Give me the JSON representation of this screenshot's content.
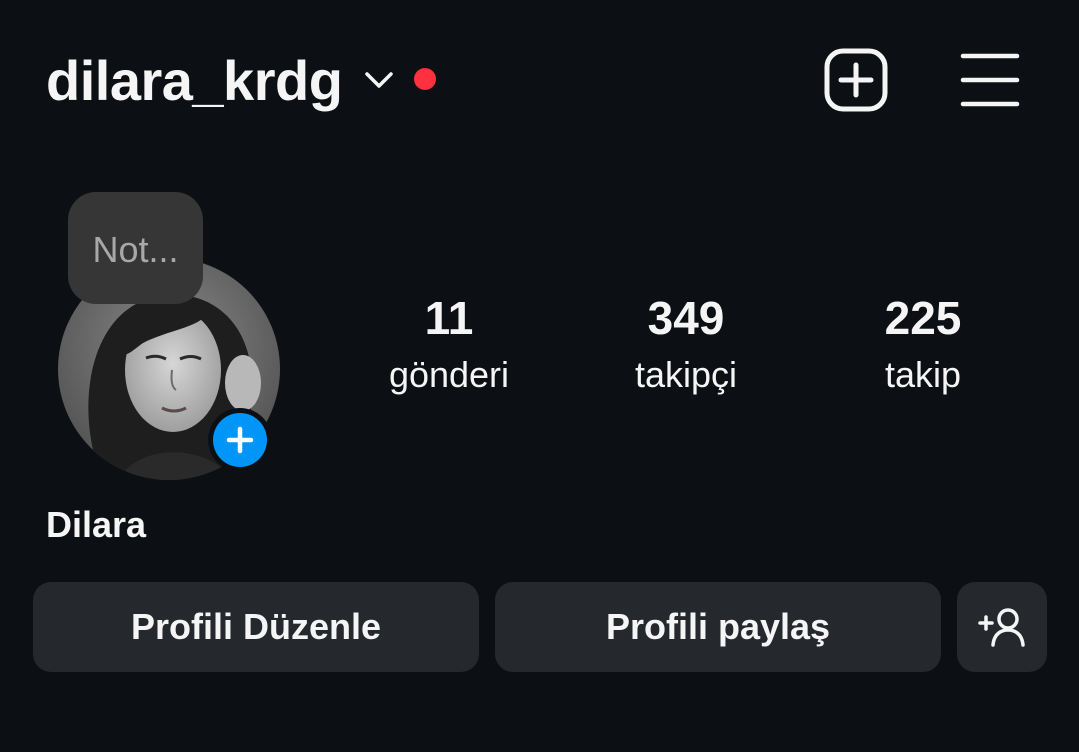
{
  "header": {
    "username": "dilara_krdg",
    "icons": {
      "account_switcher": "chevron-down-icon",
      "notification": "red-dot-icon",
      "create": "plus-square-icon",
      "menu": "hamburger-menu-icon"
    },
    "notification_color": "#ff3040"
  },
  "profile": {
    "note_placeholder": "Not...",
    "display_name": "Dilara",
    "add_story_icon": "plus-icon",
    "add_story_color": "#0095f6"
  },
  "stats": {
    "posts": {
      "count": "11",
      "label": "gönderi"
    },
    "followers": {
      "count": "349",
      "label": "takipçi"
    },
    "following": {
      "count": "225",
      "label": "takip"
    }
  },
  "actions": {
    "edit_profile": "Profili Düzenle",
    "share_profile": "Profili paylaş",
    "discover_people_icon": "add-person-icon"
  },
  "colors": {
    "background": "#0c1014",
    "button": "#25292e",
    "note_bubble": "#363636",
    "text": "#f5f5f5"
  }
}
